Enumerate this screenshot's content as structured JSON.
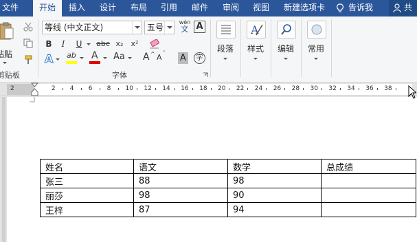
{
  "tabs": {
    "file": "文件",
    "home": "开始",
    "insert": "插入",
    "design": "设计",
    "layout": "布局",
    "references": "引用",
    "mailings": "邮件",
    "review": "审阅",
    "view": "视图",
    "newtab": "新建选项卡"
  },
  "tellme": "告诉我",
  "share": "共享",
  "clipboard": {
    "paste": "粘贴",
    "label": "剪贴板"
  },
  "font": {
    "name": "等线 (中文正文)",
    "size": "五号",
    "wen_top": "wén",
    "wen_bottom": "文",
    "border_a": "A",
    "bold": "B",
    "italic": "I",
    "underline": "U",
    "strike": "abc",
    "sub": "x₂",
    "sup": "x²",
    "highlight": "ab",
    "fontcolor": "A",
    "change_case": "Aa",
    "grow": "A",
    "shrink": "A",
    "shade_a": "A",
    "enclose": "字",
    "label": "字体",
    "highlight_color": "#ffff00",
    "font_color": "#e00000"
  },
  "paragraph": {
    "label": "段落"
  },
  "styles": {
    "label": "样式"
  },
  "editing": {
    "label": "编辑"
  },
  "common": {
    "label": "常用"
  },
  "ruler": {
    "numbers": [
      "2",
      "2",
      "4",
      "6",
      "8",
      "10",
      "12",
      "14",
      "16",
      "18",
      "20",
      "22",
      "24",
      "26",
      "28",
      "30",
      "32",
      "34",
      "36",
      "38"
    ]
  },
  "table": {
    "rows": [
      [
        "姓名",
        "语文",
        "数学",
        "总成绩"
      ],
      [
        "张三",
        "88",
        "98",
        ""
      ],
      [
        "丽莎",
        "98",
        "90",
        ""
      ],
      [
        "王梓",
        "87",
        "94",
        ""
      ]
    ]
  },
  "colors": {
    "ribbon_blue": "#2b579a"
  }
}
